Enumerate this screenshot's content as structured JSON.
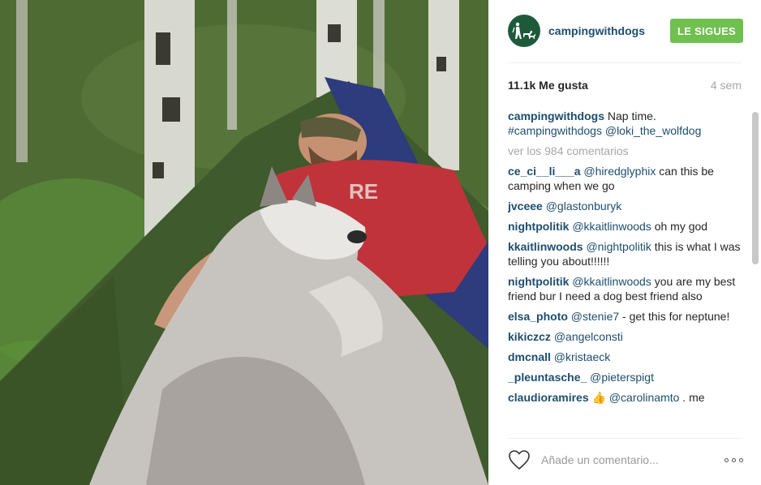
{
  "post": {
    "username": "campingwithdogs",
    "follow_label": "LE SIGUES",
    "likes": "11.1k Me gusta",
    "age": "4 sem",
    "caption": {
      "user": "campingwithdogs",
      "text1": "Nap time.",
      "hashtag": "#campingwithdogs",
      "mention": "@loki_the_wolfdog"
    },
    "view_comments": "ver los 984 comentarios",
    "comments": [
      {
        "user": "ce_ci__li___a",
        "mention": "@hiredglyphix",
        "text": " can this be camping when we go"
      },
      {
        "user": "jvceee",
        "mention": "@glastonburyk",
        "text": ""
      },
      {
        "user": "nightpolitik",
        "mention": "@kkaitlinwoods",
        "text": " oh my god"
      },
      {
        "user": "kkaitlinwoods",
        "mention": "@nightpolitik",
        "text": " this is what I was telling you about!!!!!!"
      },
      {
        "user": "nightpolitik",
        "mention": "@kkaitlinwoods",
        "text": " you are my best friend bur I need a dog best friend also"
      },
      {
        "user": "elsa_photo",
        "mention": "@stenie7",
        "text": " - get this for neptune!"
      },
      {
        "user": "kikiczcz",
        "mention": "@angelconsti",
        "text": ""
      },
      {
        "user": "dmcnall",
        "mention": "@kristaeck",
        "text": ""
      },
      {
        "user": "_pleuntasche_",
        "mention": "@pieterspigt",
        "text": ""
      },
      {
        "user": "claudioramires",
        "emoji": "👍",
        "mention": "@carolinamto",
        "text": " . me"
      }
    ],
    "add_comment_placeholder": "Añade un comentario...",
    "colors": {
      "link": "#1d4d6e",
      "follow_button": "#70c050",
      "muted": "#a5a7aa"
    },
    "icons": {
      "like": "heart-icon",
      "options": "more-options-icon",
      "avatar": "hiker-with-dogs-logo"
    }
  }
}
